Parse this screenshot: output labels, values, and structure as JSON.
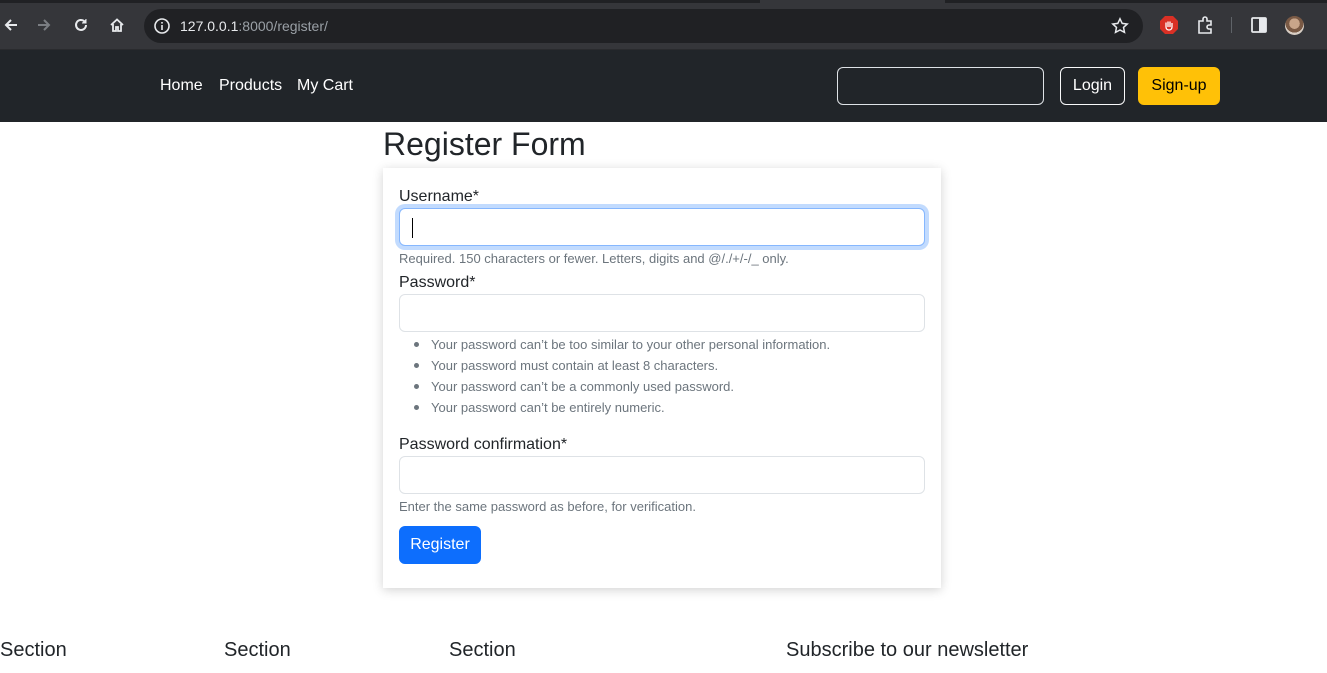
{
  "browser": {
    "url_host": "127.0.0.1",
    "url_path": ":8000/register/"
  },
  "navbar": {
    "links": [
      "Home",
      "Products",
      "My Cart"
    ],
    "search_value": "",
    "login_label": "Login",
    "signup_label": "Sign-up",
    "signup_color": "#ffc107"
  },
  "form": {
    "title": "Register Form",
    "username": {
      "label": "Username*",
      "value": "",
      "help": "Required. 150 characters or fewer. Letters, digits and @/./+/-/_ only."
    },
    "password": {
      "label": "Password*",
      "value": "",
      "rules": [
        "Your password can’t be too similar to your other personal information.",
        "Your password must contain at least 8 characters.",
        "Your password can’t be a commonly used password.",
        "Your password can’t be entirely numeric."
      ]
    },
    "password_confirmation": {
      "label": "Password confirmation*",
      "value": "",
      "help": "Enter the same password as before, for verification."
    },
    "submit_label": "Register",
    "submit_color": "#0d6efd"
  },
  "footer": {
    "headings": [
      "Section",
      "Section",
      "Section",
      "Subscribe to our newsletter"
    ]
  }
}
